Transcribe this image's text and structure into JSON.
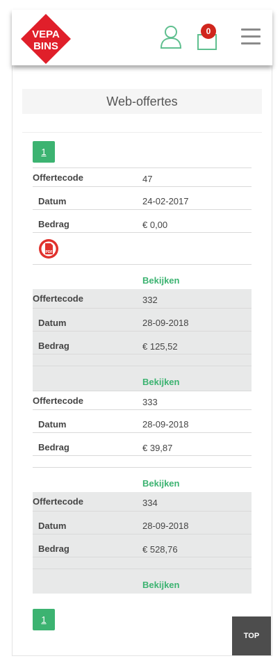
{
  "header": {
    "logo_line1": "VEPA",
    "logo_line2": "BINS",
    "cart_count": "0"
  },
  "page": {
    "title": "Web-offertes",
    "page_number": "1",
    "top_label": "TOP"
  },
  "labels": {
    "code": "Offertecode",
    "date": "Datum",
    "amount": "Bedrag",
    "view": "Bekijken"
  },
  "offers": [
    {
      "code": "47",
      "date": "24-02-2017",
      "amount": "€ 0,00"
    },
    {
      "code": "332",
      "date": "28-09-2018",
      "amount": "€ 125,52"
    },
    {
      "code": "333",
      "date": "28-09-2018",
      "amount": "€ 39,87"
    },
    {
      "code": "334",
      "date": "28-09-2018",
      "amount": "€ 528,76"
    }
  ],
  "colors": {
    "accent": "#3cb371",
    "badge": "#d0261d",
    "logo": "#e01f2a",
    "shade": "#e8e9e9"
  }
}
